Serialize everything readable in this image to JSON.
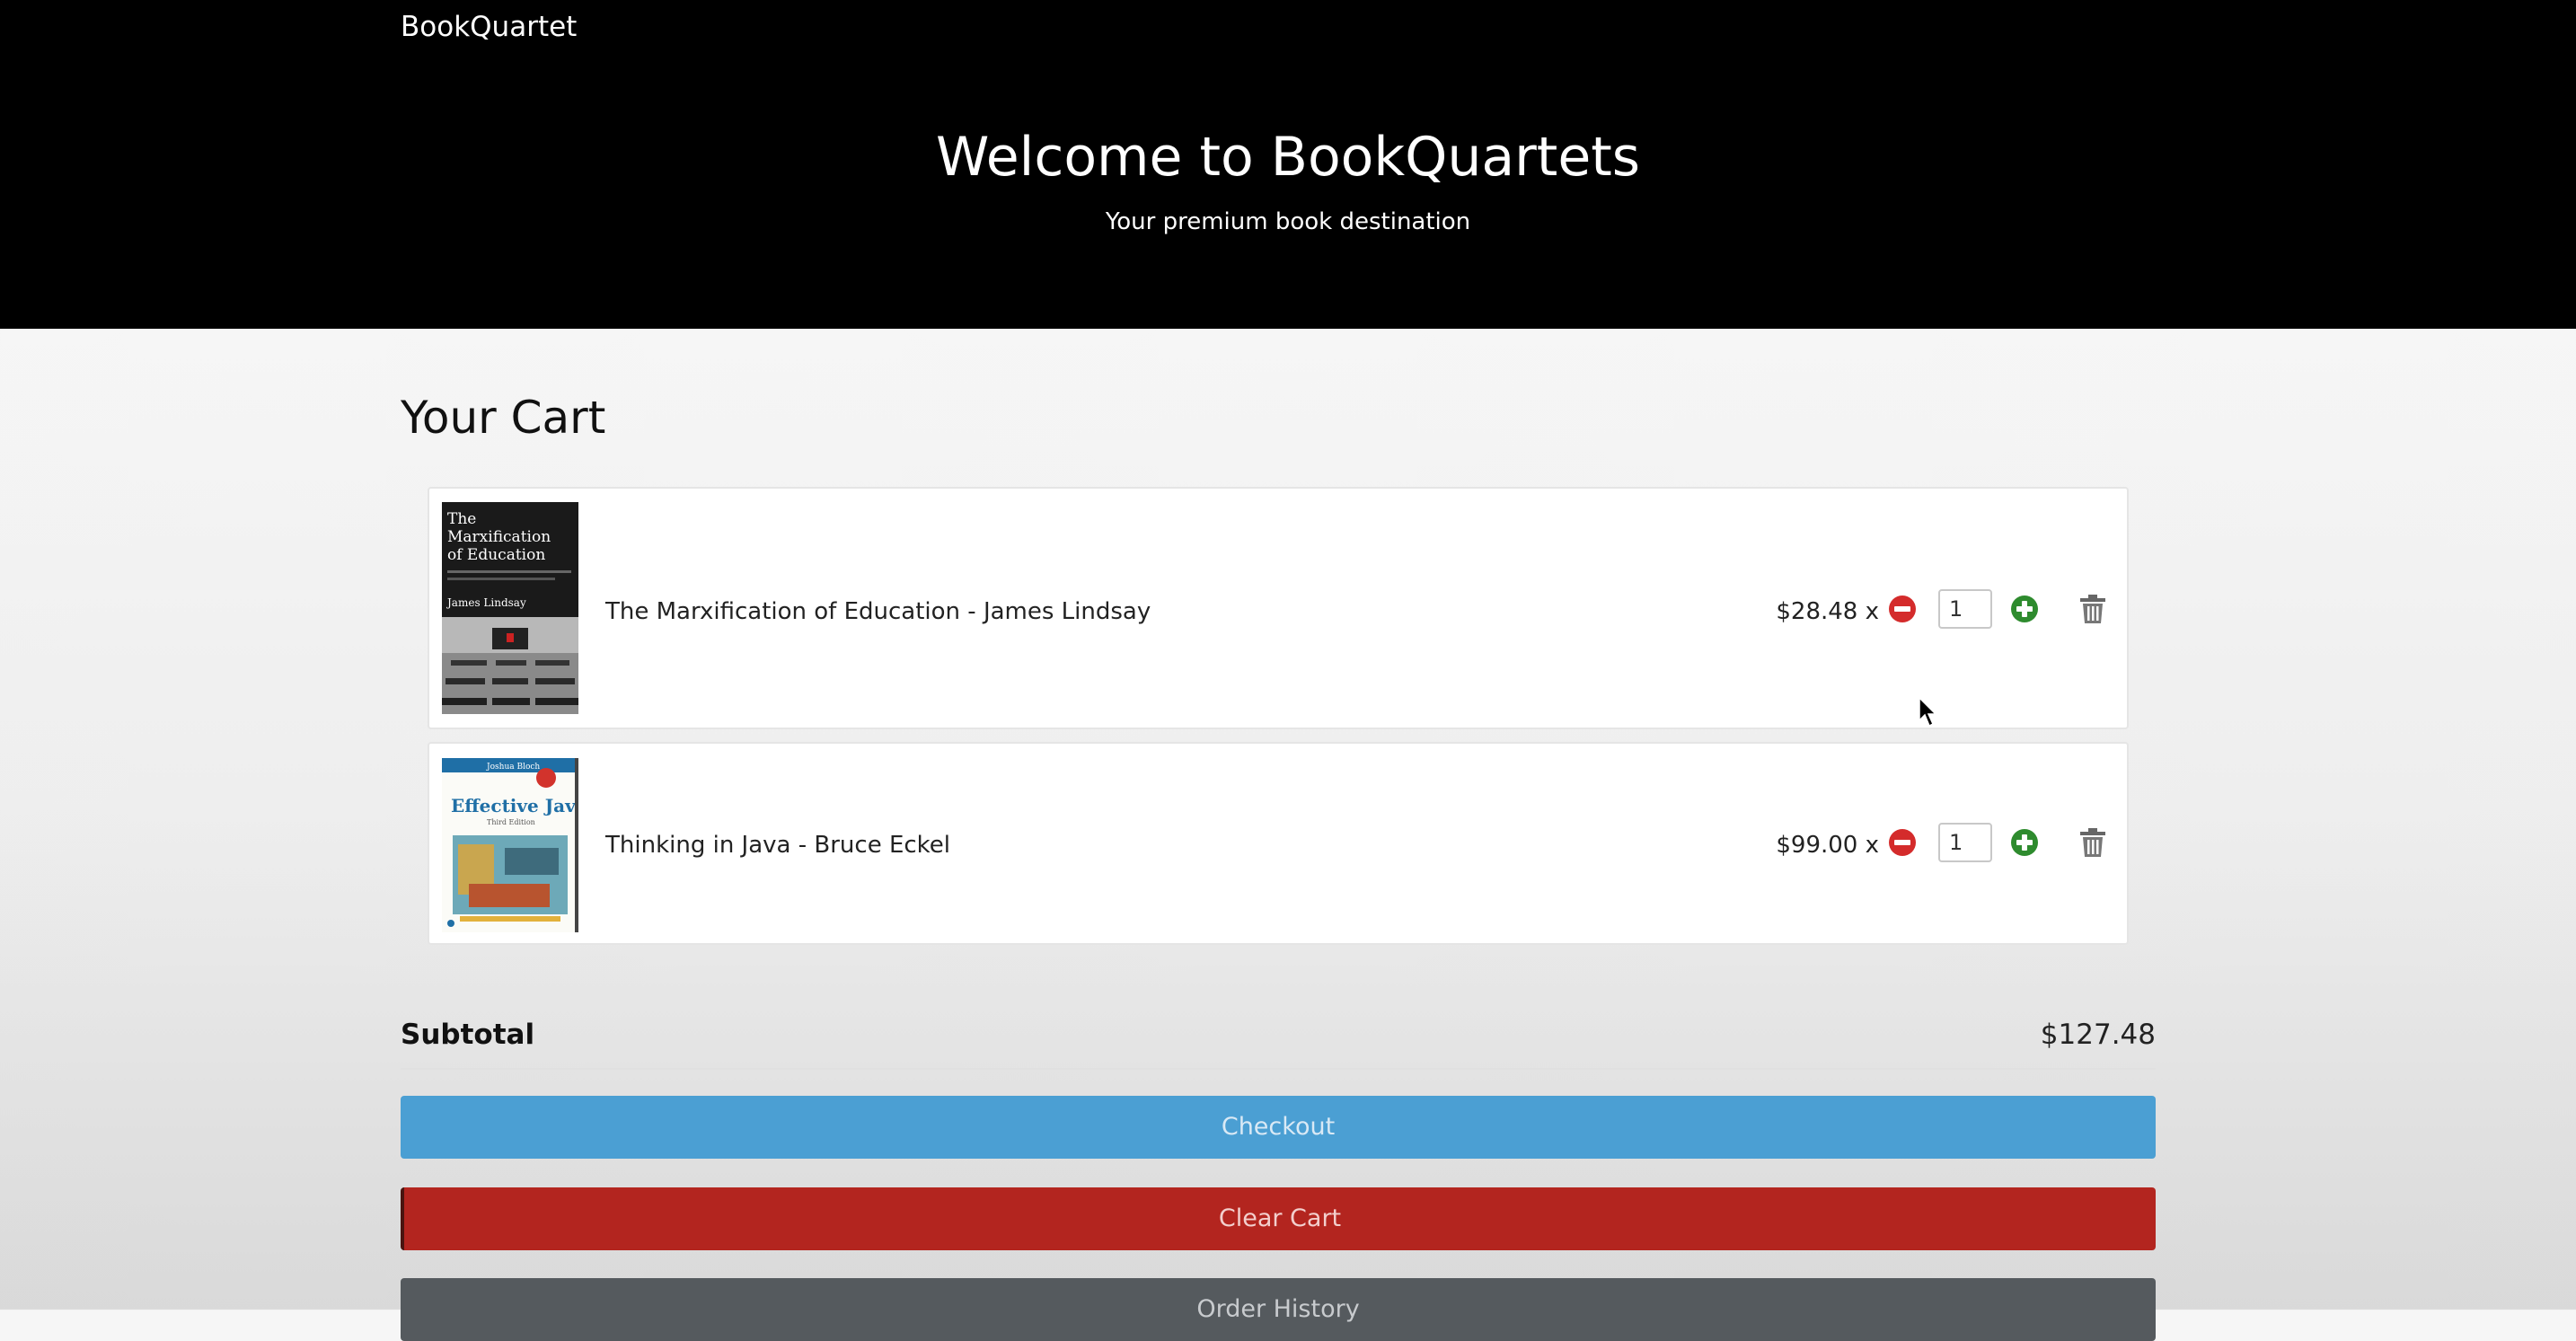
{
  "header": {
    "brand": "BookQuartet",
    "title": "Welcome to BookQuartets",
    "subtitle": "Your premium book destination"
  },
  "cart": {
    "heading": "Your Cart",
    "items": [
      {
        "title": "The Marxification of Education - James Lindsay",
        "price": "$28.48 x",
        "quantity": "1",
        "cover": {
          "line1": "The",
          "line2": "Marxification",
          "line3": "of Education",
          "author": "James Lindsay"
        }
      },
      {
        "title": "Thinking in Java - Bruce Eckel",
        "price": "$99.00 x",
        "quantity": "1",
        "cover": {
          "top": "Joshua Bloch",
          "title": "Effective Java",
          "edition": "Third Edition"
        }
      }
    ]
  },
  "summary": {
    "subtotal_label": "Subtotal",
    "subtotal_value": "$127.48"
  },
  "actions": {
    "checkout": "Checkout",
    "clear": "Clear Cart",
    "history": "Order History"
  },
  "icons": {
    "decrease": "minus-circle-icon",
    "increase": "plus-circle-icon",
    "remove": "trash-icon"
  },
  "colors": {
    "hero_bg": "#000000",
    "checkout": "#4b9fd3",
    "clear": "#b3251f",
    "history": "#555a5e",
    "minus": "#d42b2b",
    "plus": "#2e8b2e"
  }
}
